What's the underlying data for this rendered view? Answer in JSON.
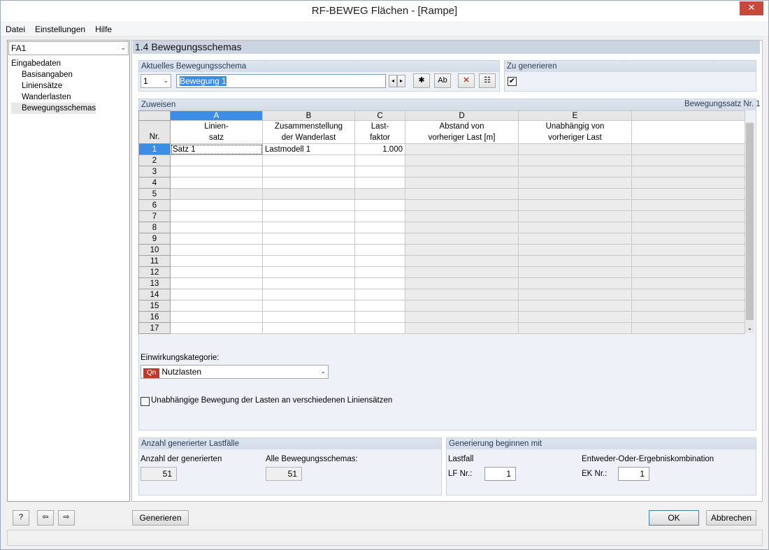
{
  "window": {
    "title": "RF-BEWEG Flächen - [Rampe]",
    "close": "✕"
  },
  "menu": [
    "Datei",
    "Einstellungen",
    "Hilfe"
  ],
  "nav": {
    "case_select": "FA1",
    "tree": [
      "Eingabedaten",
      "Basisangaben",
      "Liniensätze",
      "Wanderlasten",
      "Bewegungsschemas"
    ]
  },
  "page_title": "1.4 Bewegungsschemas",
  "current_schema": {
    "group_label": "Aktuelles Bewegungsschema",
    "number": "1",
    "name": "Bewegung 1"
  },
  "generate": {
    "group_label": "Zu generieren",
    "checked": "✔"
  },
  "assign": {
    "group_label": "Zuweisen",
    "right_label": "Bewegungssatz Nr. 1",
    "columns": [
      "A",
      "B",
      "C",
      "D",
      "E"
    ],
    "headers": {
      "nr": "Nr.",
      "a1": "Linien-",
      "a2": "satz",
      "b1": "Zusammenstellung",
      "b2": "der Wanderlast",
      "c1": "Last-",
      "c2": "faktor",
      "d1": "Abstand von",
      "d2": "vorheriger Last [m]",
      "e1": "Unabhängig von",
      "e2": "vorheriger Last"
    },
    "rows": [
      {
        "nr": "1",
        "a": "Satz 1",
        "b": "Lastmodell 1",
        "c": "1.000"
      },
      {
        "nr": "2",
        "a": "",
        "b": "",
        "c": ""
      },
      {
        "nr": "3",
        "a": "",
        "b": "",
        "c": ""
      },
      {
        "nr": "4",
        "a": "",
        "b": "",
        "c": ""
      },
      {
        "nr": "5",
        "a": "",
        "b": "",
        "c": ""
      },
      {
        "nr": "6",
        "a": "",
        "b": "",
        "c": ""
      },
      {
        "nr": "7",
        "a": "",
        "b": "",
        "c": ""
      },
      {
        "nr": "8",
        "a": "",
        "b": "",
        "c": ""
      },
      {
        "nr": "9",
        "a": "",
        "b": "",
        "c": ""
      },
      {
        "nr": "10",
        "a": "",
        "b": "",
        "c": ""
      },
      {
        "nr": "11",
        "a": "",
        "b": "",
        "c": ""
      },
      {
        "nr": "12",
        "a": "",
        "b": "",
        "c": ""
      },
      {
        "nr": "13",
        "a": "",
        "b": "",
        "c": ""
      },
      {
        "nr": "14",
        "a": "",
        "b": "",
        "c": ""
      },
      {
        "nr": "15",
        "a": "",
        "b": "",
        "c": ""
      },
      {
        "nr": "16",
        "a": "",
        "b": "",
        "c": ""
      },
      {
        "nr": "17",
        "a": "",
        "b": "",
        "c": ""
      }
    ]
  },
  "action_category": {
    "label": "Einwirkungskategorie:",
    "badge": "Qn",
    "value": "Nutzlasten"
  },
  "independent_motion": {
    "label": "Unabhängige Bewegung der Lasten an verschiedenen Liniensätzen"
  },
  "count": {
    "group_label": "Anzahl generierter Lastfälle",
    "generated_label": "Anzahl der generierten",
    "generated_value": "51",
    "all_label": "Alle Bewegungsschemas:",
    "all_value": "51"
  },
  "start": {
    "group_label": "Generierung beginnen mit",
    "lf_heading": "Lastfall",
    "lf_label": "LF Nr.:",
    "lf_value": "1",
    "ek_heading": "Entweder-Oder-Ergebniskombination",
    "ek_label": "EK Nr.:",
    "ek_value": "1"
  },
  "buttons": {
    "generate": "Generieren",
    "ok": "OK",
    "cancel": "Abbrechen"
  },
  "colors": {
    "accent": "#3b8de6",
    "badge": "#c0392b",
    "header": "#cbd5e1"
  }
}
